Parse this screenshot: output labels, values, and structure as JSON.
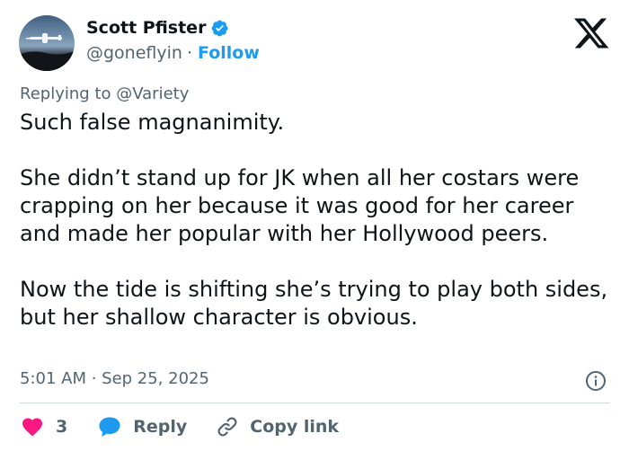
{
  "author": {
    "display_name": "Scott Pfister",
    "handle": "@goneflyin",
    "separator": "·",
    "follow_label": "Follow",
    "verified": true,
    "avatar_icon": "airplane-avatar"
  },
  "reply_context": {
    "prefix": "Replying to",
    "mention": "@Variety"
  },
  "tweet": {
    "paragraphs": [
      "Such false magnanimity.",
      "She didn’t stand up for JK when all her costars were crapping on her because it was good for her career and made her popular with her Hollywood peers.",
      "Now the tide is shifting she’s trying to play both sides, but her shallow character is obvious."
    ],
    "timestamp": "5:01 AM · Sep 25, 2025"
  },
  "actions": {
    "like_count": "3",
    "reply_label": "Reply",
    "copy_link_label": "Copy link"
  },
  "icons": {
    "logo": "x-logo-icon",
    "verified": "verified-badge-icon",
    "info": "info-icon",
    "like": "heart-icon",
    "reply": "speech-bubble-icon",
    "copy": "link-icon"
  },
  "colors": {
    "text": "#0f1419",
    "secondary": "#536471",
    "accent": "#1d9bf0",
    "like": "#f91880",
    "divider": "#cfd9de"
  }
}
